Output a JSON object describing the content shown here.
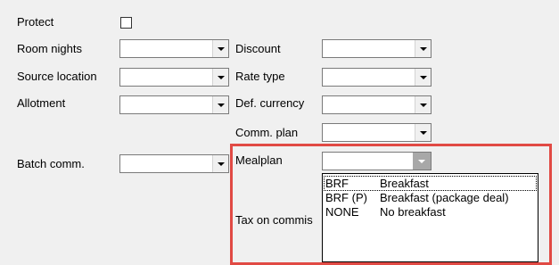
{
  "form": {
    "protect_label": "Protect",
    "protect_checked": false,
    "room_nights_label": "Room nights",
    "room_nights_value": "",
    "source_location_label": "Source location",
    "source_location_value": "",
    "allotment_label": "Allotment",
    "allotment_value": "",
    "batch_comm_label": "Batch comm.",
    "batch_comm_value": "",
    "discount_label": "Discount",
    "discount_value": "",
    "rate_type_label": "Rate type",
    "rate_type_value": "",
    "def_currency_label": "Def. currency",
    "def_currency_value": "",
    "comm_plan_label": "Comm. plan",
    "comm_plan_value": "",
    "mealplan_label": "Mealplan",
    "mealplan_value": "",
    "tax_on_commission_label": "Tax on commis"
  },
  "mealplan_options": [
    {
      "code": "BRF",
      "description": "Breakfast"
    },
    {
      "code": "BRF (P)",
      "description": "Breakfast (package deal)"
    },
    {
      "code": "NONE",
      "description": "No breakfast"
    }
  ],
  "colors": {
    "highlight_border": "#e14a44",
    "window_background": "#f0f0f0"
  }
}
